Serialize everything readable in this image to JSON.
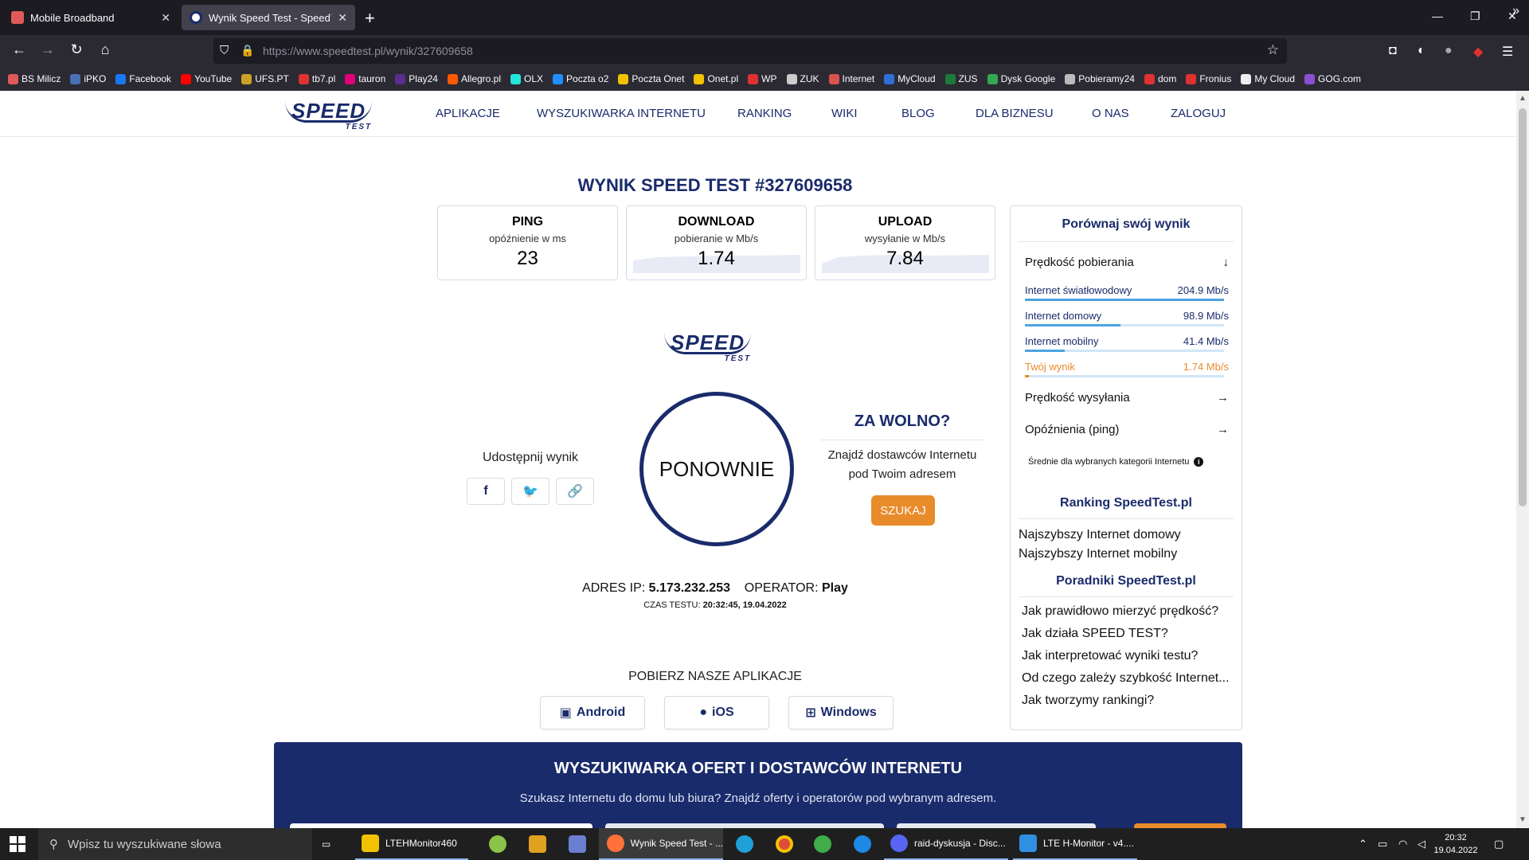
{
  "browser": {
    "tabs": [
      {
        "title": "Mobile Broadband",
        "active": false,
        "favicon_color": "#e05a5a"
      },
      {
        "title": "Wynik Speed Test - SpeedTest.pl",
        "active": true,
        "favicon_color": "#ffffff"
      }
    ],
    "new_tab_label": "+",
    "url_host": "https://www.speedtest.pl",
    "url_path": "/wynik/327609658",
    "bookmarks": [
      {
        "label": "BS Milicz",
        "color": "#e05a5a"
      },
      {
        "label": "iPKO",
        "color": "#4a6fb5"
      },
      {
        "label": "Facebook",
        "color": "#1877f2"
      },
      {
        "label": "YouTube",
        "color": "#ff0000"
      },
      {
        "label": "UFS.PT",
        "color": "#c9a227"
      },
      {
        "label": "tb7.pl",
        "color": "#d33"
      },
      {
        "label": "tauron",
        "color": "#e0007a"
      },
      {
        "label": "Play24",
        "color": "#5b2d90"
      },
      {
        "label": "Allegro.pl",
        "color": "#ff5a00"
      },
      {
        "label": "OLX",
        "color": "#23e5db"
      },
      {
        "label": "Poczta o2",
        "color": "#1e90ff"
      },
      {
        "label": "Poczta Onet",
        "color": "#f2c200"
      },
      {
        "label": "Onet.pl",
        "color": "#f2c200"
      },
      {
        "label": "WP",
        "color": "#e03131"
      },
      {
        "label": "ZUK",
        "color": "#cccccc"
      },
      {
        "label": "Internet",
        "color": "#d9534f"
      },
      {
        "label": "MyCloud",
        "color": "#2f6fd6"
      },
      {
        "label": "ZUS",
        "color": "#1d7a3a"
      },
      {
        "label": "Dysk Google",
        "color": "#34a853"
      },
      {
        "label": "Pobieramy24",
        "color": "#bbbbbb"
      },
      {
        "label": "dom",
        "color": "#e03131"
      },
      {
        "label": "Fronius",
        "color": "#e03131"
      },
      {
        "label": "My Cloud",
        "color": "#eeeeee"
      },
      {
        "label": "GOG.com",
        "color": "#8a4fd1"
      }
    ]
  },
  "site": {
    "logo_main": "SPEED",
    "logo_sub": "TEST",
    "menu": [
      "APLIKACJE",
      "WYSZUKIWARKA INTERNETU",
      "RANKING",
      "WIKI",
      "BLOG",
      "DLA BIZNESU",
      "O NAS",
      "ZALOGUJ"
    ]
  },
  "result": {
    "title": "WYNIK SPEED TEST #327609658",
    "cards": [
      {
        "title": "PING",
        "subtitle": "opóźnienie w ms",
        "value": "23"
      },
      {
        "title": "DOWNLOAD",
        "subtitle": "pobieranie w Mb/s",
        "value": "1.74"
      },
      {
        "title": "UPLOAD",
        "subtitle": "wysyłanie w Mb/s",
        "value": "7.84"
      }
    ],
    "share_label": "Udostępnij wynik",
    "again_label": "PONOWNIE",
    "slow": {
      "title": "ZA WOLNO?",
      "text_line1": "Znajdź dostawców Internetu",
      "text_line2": "pod Twoim adresem",
      "button": "SZUKAJ"
    },
    "ip_label": "ADRES IP:",
    "ip_value": "5.173.232.253",
    "operator_label": "OPERATOR:",
    "operator_value": "Play",
    "time_label": "CZAS TESTU:",
    "time_value": "20:32:45, 19.04.2022"
  },
  "apps": {
    "title": "POBIERZ NASZE APLIKACJE",
    "buttons": [
      "Android",
      "iOS",
      "Windows"
    ]
  },
  "sidebar": {
    "compare_title": "Porównaj swój wynik",
    "download_section": "Prędkość pobierania",
    "rows": [
      {
        "label": "Internet światłowodowy",
        "value": "204.9 Mb/s",
        "share": 1.0,
        "highlight": false
      },
      {
        "label": "Internet domowy",
        "value": "98.9 Mb/s",
        "share": 0.48,
        "highlight": false
      },
      {
        "label": "Internet mobilny",
        "value": "41.4 Mb/s",
        "share": 0.2,
        "highlight": false
      },
      {
        "label": "Twój wynik",
        "value": "1.74 Mb/s",
        "share": 0.01,
        "highlight": true
      }
    ],
    "upload_section": "Prędkość wysyłania",
    "ping_section": "Opóźnienia (ping)",
    "note": "Średnie dla wybranych kategorii Internetu",
    "ranking_title": "Ranking SpeedTest.pl",
    "ranking_links": [
      "Najszybszy Internet domowy",
      "Najszybszy Internet mobilny"
    ],
    "guides_title": "Poradniki SpeedTest.pl",
    "guide_links": [
      "Jak prawidłowo mierzyć prędkość?",
      "Jak działa SPEED TEST?",
      "Jak interpretować wyniki testu?",
      "Od czego zależy szybkość Internet...",
      "Jak tworzymy rankingi?"
    ]
  },
  "banner": {
    "title": "WYSZUKIWARKA OFERT I DOSTAWCÓW INTERNETU",
    "subtitle": "Szukasz Internetu do domu lub biura? Znajdź oferty i operatorów pod wybranym adresem."
  },
  "taskbar": {
    "search_placeholder": "Wpisz tu wyszukiwane słowa",
    "items": [
      {
        "label": "LTEHMonitor460",
        "color": "#f2c200"
      },
      {
        "label": "Wynik Speed Test - ...",
        "color": "#ff7139"
      },
      {
        "label": "raid-dyskusja - Disc...",
        "color": "#5865f2"
      },
      {
        "label": "LTE H-Monitor - v4....",
        "color": "#2f8fe0"
      }
    ],
    "time": "20:32",
    "date": "19.04.2022"
  },
  "colors": {
    "brand": "#1a2b6b",
    "accent": "#e88b2a",
    "bar": "#4da3e0"
  }
}
